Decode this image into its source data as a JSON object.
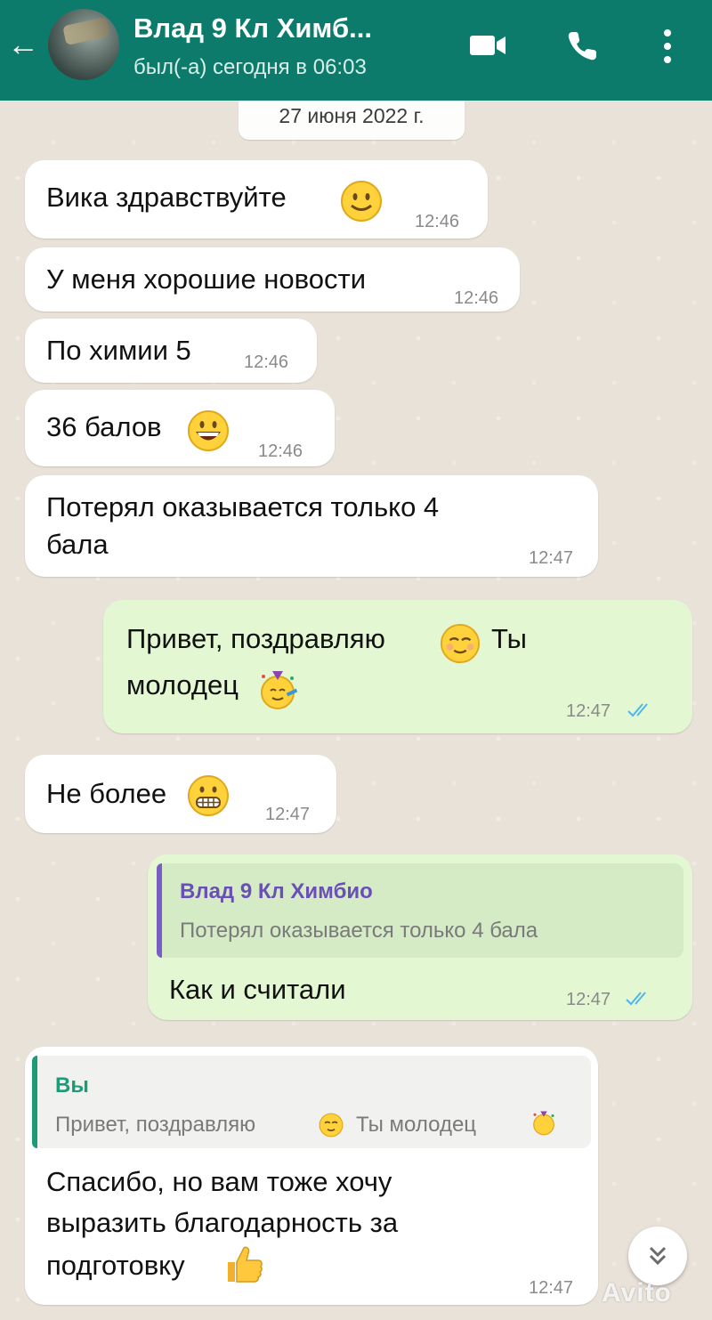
{
  "header": {
    "title": "Влад 9 Кл Химб...",
    "status": "был(-а) сегодня в 06:03",
    "accent_color": "#0c7b6b",
    "icons": [
      "back-arrow-icon",
      "video-call-icon",
      "phone-icon",
      "more-vert-icon"
    ]
  },
  "date_chip": "27 июня 2022 г.",
  "messages": [
    {
      "dir": "in",
      "text": "Вика здравствуйте",
      "emoji": "slightly-smiling-face",
      "time": "12:46"
    },
    {
      "dir": "in",
      "text": "У меня хорошие новости",
      "time": "12:46"
    },
    {
      "dir": "in",
      "text": "По химии 5",
      "time": "12:46"
    },
    {
      "dir": "in",
      "text": "36 балов",
      "emoji": "grinning-face",
      "time": "12:46"
    },
    {
      "dir": "in",
      "lines": [
        "Потерял оказывается только 4",
        "бала"
      ],
      "time": "12:47"
    },
    {
      "dir": "out",
      "lines": [
        "Привет, поздравляю",
        "Ты",
        "молодец"
      ],
      "emojis": [
        "relieved-face",
        "party-face"
      ],
      "time": "12:47",
      "status": "read"
    },
    {
      "dir": "in",
      "text": "Не более",
      "emoji": "grimacing-face",
      "time": "12:47"
    },
    {
      "dir": "out",
      "quote": {
        "author": "Влад 9 Кл Химбио",
        "text": "Потерял оказывается только 4 бала"
      },
      "text": "Как и считали",
      "time": "12:47",
      "status": "read"
    },
    {
      "dir": "in",
      "quote": {
        "author": "Вы",
        "text_a": "Привет, поздравляю",
        "text_b": "Ты молодец"
      },
      "lines": [
        "Спасибо, но вам тоже хочу",
        "выразить благодарность за",
        "подготовку"
      ],
      "emoji": "thumbs-up",
      "time": "12:47"
    }
  ],
  "watermark": "Avito",
  "colors": {
    "incoming_bubble": "#ffffff",
    "outgoing_bubble": "#e3f7d2",
    "read_tick": "#4fb6ec",
    "quote_bar_out": "#7b5bc4",
    "quote_bar_in": "#1d9b76"
  }
}
